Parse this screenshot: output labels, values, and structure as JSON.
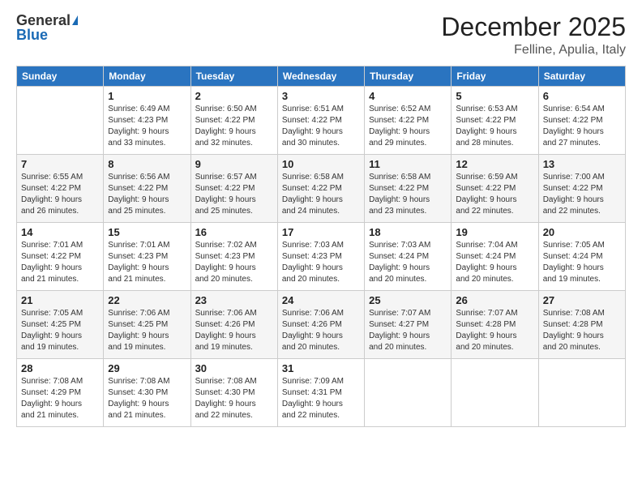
{
  "logo": {
    "general": "General",
    "blue": "Blue"
  },
  "header": {
    "month": "December 2025",
    "location": "Felline, Apulia, Italy"
  },
  "days_of_week": [
    "Sunday",
    "Monday",
    "Tuesday",
    "Wednesday",
    "Thursday",
    "Friday",
    "Saturday"
  ],
  "weeks": [
    [
      {
        "day": "",
        "info": ""
      },
      {
        "day": "1",
        "info": "Sunrise: 6:49 AM\nSunset: 4:23 PM\nDaylight: 9 hours\nand 33 minutes."
      },
      {
        "day": "2",
        "info": "Sunrise: 6:50 AM\nSunset: 4:22 PM\nDaylight: 9 hours\nand 32 minutes."
      },
      {
        "day": "3",
        "info": "Sunrise: 6:51 AM\nSunset: 4:22 PM\nDaylight: 9 hours\nand 30 minutes."
      },
      {
        "day": "4",
        "info": "Sunrise: 6:52 AM\nSunset: 4:22 PM\nDaylight: 9 hours\nand 29 minutes."
      },
      {
        "day": "5",
        "info": "Sunrise: 6:53 AM\nSunset: 4:22 PM\nDaylight: 9 hours\nand 28 minutes."
      },
      {
        "day": "6",
        "info": "Sunrise: 6:54 AM\nSunset: 4:22 PM\nDaylight: 9 hours\nand 27 minutes."
      }
    ],
    [
      {
        "day": "7",
        "info": "Sunrise: 6:55 AM\nSunset: 4:22 PM\nDaylight: 9 hours\nand 26 minutes."
      },
      {
        "day": "8",
        "info": "Sunrise: 6:56 AM\nSunset: 4:22 PM\nDaylight: 9 hours\nand 25 minutes."
      },
      {
        "day": "9",
        "info": "Sunrise: 6:57 AM\nSunset: 4:22 PM\nDaylight: 9 hours\nand 25 minutes."
      },
      {
        "day": "10",
        "info": "Sunrise: 6:58 AM\nSunset: 4:22 PM\nDaylight: 9 hours\nand 24 minutes."
      },
      {
        "day": "11",
        "info": "Sunrise: 6:58 AM\nSunset: 4:22 PM\nDaylight: 9 hours\nand 23 minutes."
      },
      {
        "day": "12",
        "info": "Sunrise: 6:59 AM\nSunset: 4:22 PM\nDaylight: 9 hours\nand 22 minutes."
      },
      {
        "day": "13",
        "info": "Sunrise: 7:00 AM\nSunset: 4:22 PM\nDaylight: 9 hours\nand 22 minutes."
      }
    ],
    [
      {
        "day": "14",
        "info": "Sunrise: 7:01 AM\nSunset: 4:22 PM\nDaylight: 9 hours\nand 21 minutes."
      },
      {
        "day": "15",
        "info": "Sunrise: 7:01 AM\nSunset: 4:23 PM\nDaylight: 9 hours\nand 21 minutes."
      },
      {
        "day": "16",
        "info": "Sunrise: 7:02 AM\nSunset: 4:23 PM\nDaylight: 9 hours\nand 20 minutes."
      },
      {
        "day": "17",
        "info": "Sunrise: 7:03 AM\nSunset: 4:23 PM\nDaylight: 9 hours\nand 20 minutes."
      },
      {
        "day": "18",
        "info": "Sunrise: 7:03 AM\nSunset: 4:24 PM\nDaylight: 9 hours\nand 20 minutes."
      },
      {
        "day": "19",
        "info": "Sunrise: 7:04 AM\nSunset: 4:24 PM\nDaylight: 9 hours\nand 20 minutes."
      },
      {
        "day": "20",
        "info": "Sunrise: 7:05 AM\nSunset: 4:24 PM\nDaylight: 9 hours\nand 19 minutes."
      }
    ],
    [
      {
        "day": "21",
        "info": "Sunrise: 7:05 AM\nSunset: 4:25 PM\nDaylight: 9 hours\nand 19 minutes."
      },
      {
        "day": "22",
        "info": "Sunrise: 7:06 AM\nSunset: 4:25 PM\nDaylight: 9 hours\nand 19 minutes."
      },
      {
        "day": "23",
        "info": "Sunrise: 7:06 AM\nSunset: 4:26 PM\nDaylight: 9 hours\nand 19 minutes."
      },
      {
        "day": "24",
        "info": "Sunrise: 7:06 AM\nSunset: 4:26 PM\nDaylight: 9 hours\nand 20 minutes."
      },
      {
        "day": "25",
        "info": "Sunrise: 7:07 AM\nSunset: 4:27 PM\nDaylight: 9 hours\nand 20 minutes."
      },
      {
        "day": "26",
        "info": "Sunrise: 7:07 AM\nSunset: 4:28 PM\nDaylight: 9 hours\nand 20 minutes."
      },
      {
        "day": "27",
        "info": "Sunrise: 7:08 AM\nSunset: 4:28 PM\nDaylight: 9 hours\nand 20 minutes."
      }
    ],
    [
      {
        "day": "28",
        "info": "Sunrise: 7:08 AM\nSunset: 4:29 PM\nDaylight: 9 hours\nand 21 minutes."
      },
      {
        "day": "29",
        "info": "Sunrise: 7:08 AM\nSunset: 4:30 PM\nDaylight: 9 hours\nand 21 minutes."
      },
      {
        "day": "30",
        "info": "Sunrise: 7:08 AM\nSunset: 4:30 PM\nDaylight: 9 hours\nand 22 minutes."
      },
      {
        "day": "31",
        "info": "Sunrise: 7:09 AM\nSunset: 4:31 PM\nDaylight: 9 hours\nand 22 minutes."
      },
      {
        "day": "",
        "info": ""
      },
      {
        "day": "",
        "info": ""
      },
      {
        "day": "",
        "info": ""
      }
    ]
  ]
}
